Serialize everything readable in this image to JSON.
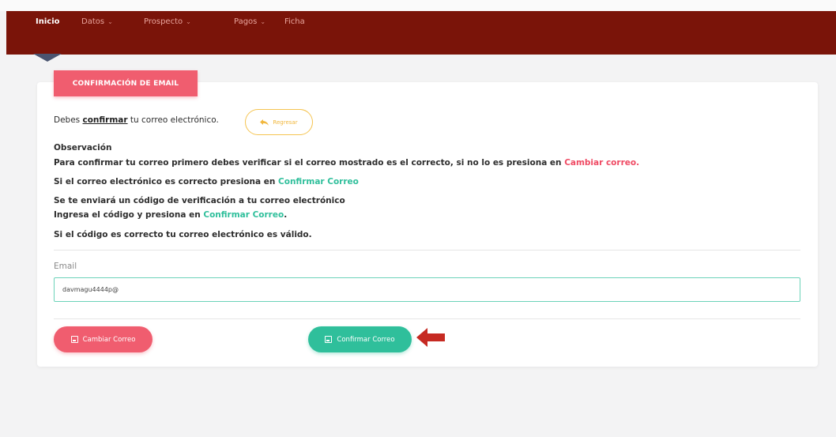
{
  "nav": {
    "items": [
      {
        "label": "Inicio",
        "active": true
      },
      {
        "label": "Datos",
        "dropdown": true
      },
      {
        "label": "Prospecto",
        "dropdown": true
      },
      {
        "label": "Pagos",
        "dropdown": true
      },
      {
        "label": "Ficha",
        "dropdown": false
      }
    ],
    "caret": "⌄"
  },
  "header": {
    "title": "CONFIRMACIÓN DE EMAIL"
  },
  "intro": {
    "prefix": "Debes",
    "link": "confirmar",
    "suffix": "tu correo electrónico.",
    "back_button": "Regresar"
  },
  "observacion": {
    "title": "Observación",
    "line1_text": "Para confirmar tu correo primero debes verificar si el correo mostrado es el correcto, si no lo es presiona en",
    "line1_link": "Cambiar correo.",
    "line2_text": "Si el correo electrónico es correcto presiona en",
    "line2_link": "Confirmar Correo",
    "line3_text": "Se te enviará un código de verificación a tu correo electrónico",
    "line4_text": "Ingresa el código y presiona en",
    "line4_link": "Confirmar Correo",
    "line4_end": ".",
    "line5_text": "Si el código es correcto tu correo electrónico es válido."
  },
  "form": {
    "email_label": "Email",
    "email_value": "davmagu4444p@"
  },
  "buttons": {
    "change": "Cambiar Correo",
    "confirm": "Confirmar Correo"
  },
  "colors": {
    "navbar": "#7a1409",
    "accent_red": "#f05d6f",
    "accent_green": "#2fbf9b",
    "accent_yellow": "#f5c451",
    "arrow": "#c62a22"
  },
  "icons": {
    "back": "reply-arrow-icon",
    "save": "floppy-disk-icon",
    "indicator": "left-arrow-icon"
  }
}
